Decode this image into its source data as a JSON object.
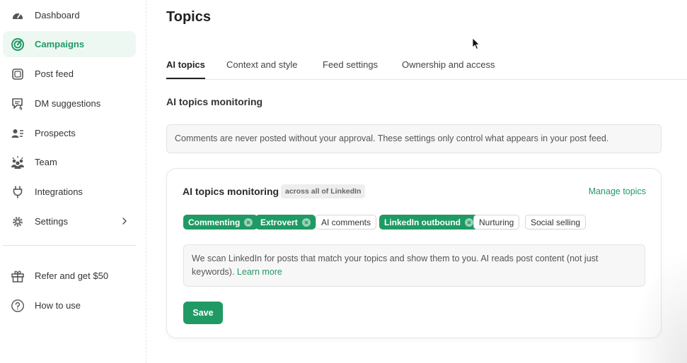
{
  "sidebar": {
    "items": [
      {
        "label": "Dashboard",
        "icon": "gauge-icon"
      },
      {
        "label": "Campaigns",
        "icon": "target-icon",
        "active": true
      },
      {
        "label": "Post feed",
        "icon": "post-feed-icon"
      },
      {
        "label": "DM suggestions",
        "icon": "chat-bolt-icon"
      },
      {
        "label": "Prospects",
        "icon": "contact-list-icon"
      },
      {
        "label": "Team",
        "icon": "team-icon"
      },
      {
        "label": "Integrations",
        "icon": "plug-icon"
      },
      {
        "label": "Settings",
        "icon": "gear-icon"
      }
    ],
    "footer": [
      {
        "label": "Refer and get $50",
        "icon": "gift-icon"
      },
      {
        "label": "How to use",
        "icon": "help-circle-icon"
      }
    ]
  },
  "page": {
    "title": "Topics",
    "tabs": [
      "AI topics",
      "Context and style",
      "Feed settings",
      "Ownership and access"
    ],
    "active_tab": "AI topics",
    "section_title": "AI topics monitoring",
    "notice": "Comments are never posted without your approval. These settings only control what appears in your post feed."
  },
  "card": {
    "title": "AI topics monitoring",
    "scope_badge": "across all of LinkedIn",
    "manage_link": "Manage topics",
    "chips": [
      {
        "label": "Commenting",
        "selected": true
      },
      {
        "label": "Extrovert",
        "selected": true
      },
      {
        "label": "AI comments",
        "selected": false
      },
      {
        "label": "LinkedIn outbound",
        "selected": true
      },
      {
        "label": "Nurturing",
        "selected": false
      },
      {
        "label": "Social selling",
        "selected": false
      }
    ],
    "info_text": "We scan LinkedIn for posts that match your topics and show them to you. AI reads post content (not just keywords).",
    "info_link": "Learn more",
    "save_label": "Save"
  },
  "colors": {
    "accent": "#1f9a64",
    "active_nav_bg": "#eef8f3",
    "notice_bg": "#f7f7f7"
  }
}
